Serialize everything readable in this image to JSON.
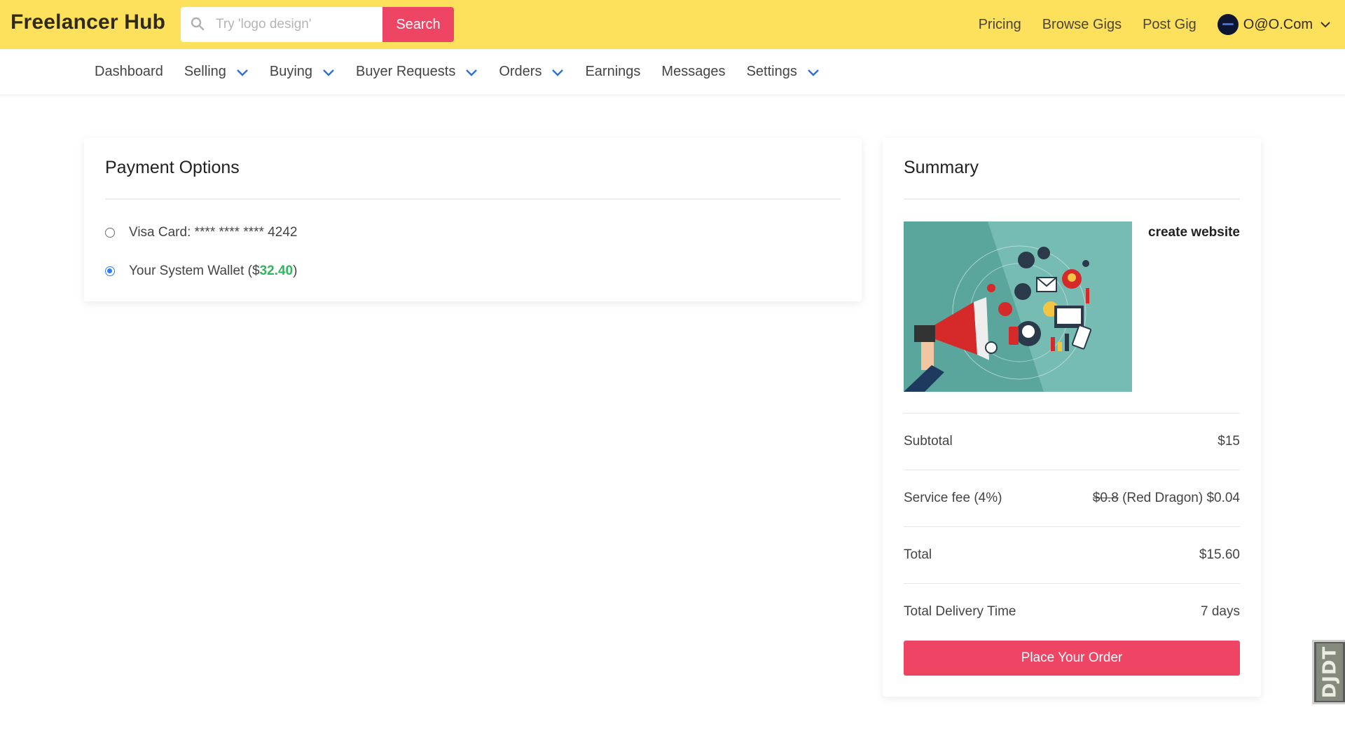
{
  "brand": "Freelancer Hub",
  "search": {
    "placeholder": "Try 'logo design'",
    "button_label": "Search"
  },
  "topnav": {
    "links": [
      "Pricing",
      "Browse Gigs",
      "Post Gig"
    ],
    "user_name": "O@O.Com"
  },
  "subnav": {
    "items": [
      {
        "label": "Dashboard",
        "has_dropdown": false
      },
      {
        "label": "Selling",
        "has_dropdown": true
      },
      {
        "label": "Buying",
        "has_dropdown": true
      },
      {
        "label": "Buyer Requests",
        "has_dropdown": true
      },
      {
        "label": "Orders",
        "has_dropdown": true
      },
      {
        "label": "Earnings",
        "has_dropdown": false
      },
      {
        "label": "Messages",
        "has_dropdown": false
      },
      {
        "label": "Settings",
        "has_dropdown": true
      }
    ]
  },
  "payment": {
    "title": "Payment Options",
    "visa_label": "Visa Card: **** **** **** 4242",
    "wallet_prefix": "Your System Wallet ($",
    "wallet_amount": "32.40",
    "wallet_suffix": ")",
    "selected": "wallet"
  },
  "summary": {
    "title": "Summary",
    "gig_title": "create website",
    "subtotal_label": "Subtotal",
    "subtotal_value": "$15",
    "fee_label": "Service fee (4%)",
    "fee_original": "$0.8",
    "fee_discounted": "(Red Dragon) $0.04",
    "total_label": "Total",
    "total_value": "$15.60",
    "delivery_label": "Total Delivery Time",
    "delivery_value": "7 days",
    "order_button": "Place Your Order"
  },
  "debug_toolbar": "DJDT",
  "colors": {
    "topbar": "#fde05c",
    "accent": "#ef4565",
    "wallet_amount": "#2eb85c",
    "radio_checked": "#2f7cf6",
    "chevron": "#2f6fd6"
  }
}
